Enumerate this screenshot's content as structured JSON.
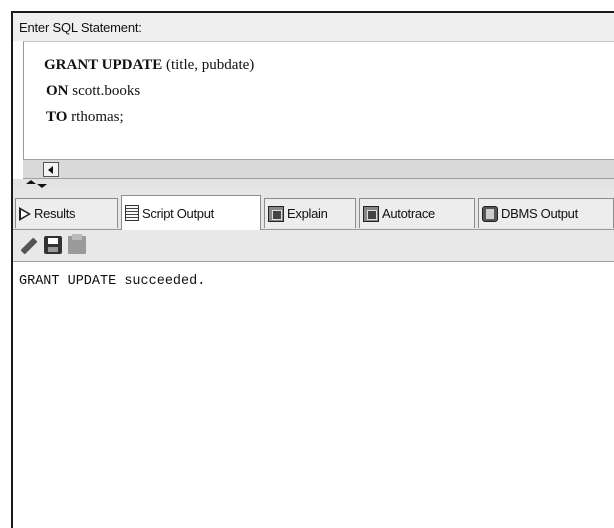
{
  "editor": {
    "label": "Enter SQL Statement:",
    "line1_kw": "GRANT UPDATE",
    "line1_rest": " (title, pubdate)",
    "line2_kw": "ON",
    "line2_rest": " scott.books",
    "line3_kw": "TO",
    "line3_rest": " rthomas;"
  },
  "tabs": [
    {
      "label": "Results",
      "icon": "play-triangle-icon"
    },
    {
      "label": "Script Output",
      "icon": "script-sheet-icon",
      "active": true
    },
    {
      "label": "Explain",
      "icon": "explain-plan-icon"
    },
    {
      "label": "Autotrace",
      "icon": "autotrace-icon"
    },
    {
      "label": "DBMS Output",
      "icon": "dbms-output-icon"
    }
  ],
  "toolbar": {
    "icons": [
      "eraser-pencil-icon",
      "save-disk-icon",
      "print-icon"
    ]
  },
  "output": {
    "text": "GRANT UPDATE succeeded."
  }
}
